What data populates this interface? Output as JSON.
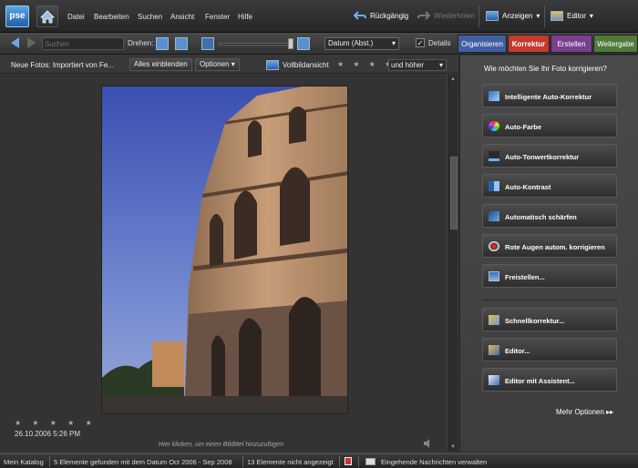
{
  "app": {
    "logo": "pse"
  },
  "menu": {
    "items": [
      "Datei",
      "Bearbeiten",
      "Suchen",
      "Ansicht",
      "Fenster",
      "Hilfe"
    ],
    "undo": "Rückgängig",
    "redo": "Wiederholen",
    "display": "Anzeigen",
    "editor": "Editor"
  },
  "toolbar": {
    "search_placeholder": "Suchen",
    "rotate_label": "Drehen:",
    "sort_value": "Datum (Abst.)",
    "details_label": "Details",
    "details_checked": true,
    "tabs": [
      {
        "label": "Organisieren",
        "color": "#3f5f9f"
      },
      {
        "label": "Korrektur",
        "color": "#c43a2c"
      },
      {
        "label": "Erstellen",
        "color": "#7b3f8f"
      },
      {
        "label": "Weitergabe",
        "color": "#4f7a3a"
      }
    ]
  },
  "subbar": {
    "new_photos": "Neue Fotos: Importiert von Fe...",
    "show_all": "Alles einblenden",
    "options": "Optionen",
    "fullscreen": "Vollbildansicht",
    "stars": "★ ★ ★ ★ ★",
    "rating_filter": "und höher"
  },
  "photo": {
    "stars": "★ ★ ★ ★ ★",
    "date": "26.10.2006 5:26 PM",
    "caption_hint": "Hier klicken, um einen Bildtitel hinzuzufügen"
  },
  "panel": {
    "title": "Wie möchten Sie Ihr Foto korrigieren?",
    "buttons": [
      {
        "label": "Intelligente Auto-Korrektur",
        "icon": "magic-wand-icon"
      },
      {
        "label": "Auto-Farbe",
        "icon": "color-wheel-icon"
      },
      {
        "label": "Auto-Tonwertkorrektur",
        "icon": "levels-icon"
      },
      {
        "label": "Auto-Kontrast",
        "icon": "contrast-icon"
      },
      {
        "label": "Automatisch schärfen",
        "icon": "sharpen-icon"
      },
      {
        "label": "Rote Augen autom. korrigieren",
        "icon": "red-eye-icon"
      },
      {
        "label": "Freistellen...",
        "icon": "crop-icon"
      },
      {
        "label": "Schnellkorrektur...",
        "icon": "quick-fix-icon"
      },
      {
        "label": "Editor...",
        "icon": "editor-icon"
      },
      {
        "label": "Editor mit Assistent...",
        "icon": "guided-editor-icon"
      }
    ],
    "more_options": "Mehr Optionen"
  },
  "status": {
    "catalog": "Mein Katalog",
    "found": "5 Elemente gefunden mit dem Datum Oct 2006 - Sep 2008",
    "hidden": "13 Elemente nicht angezeigt",
    "messages": "Eingehende Nachrichten verwalten"
  }
}
